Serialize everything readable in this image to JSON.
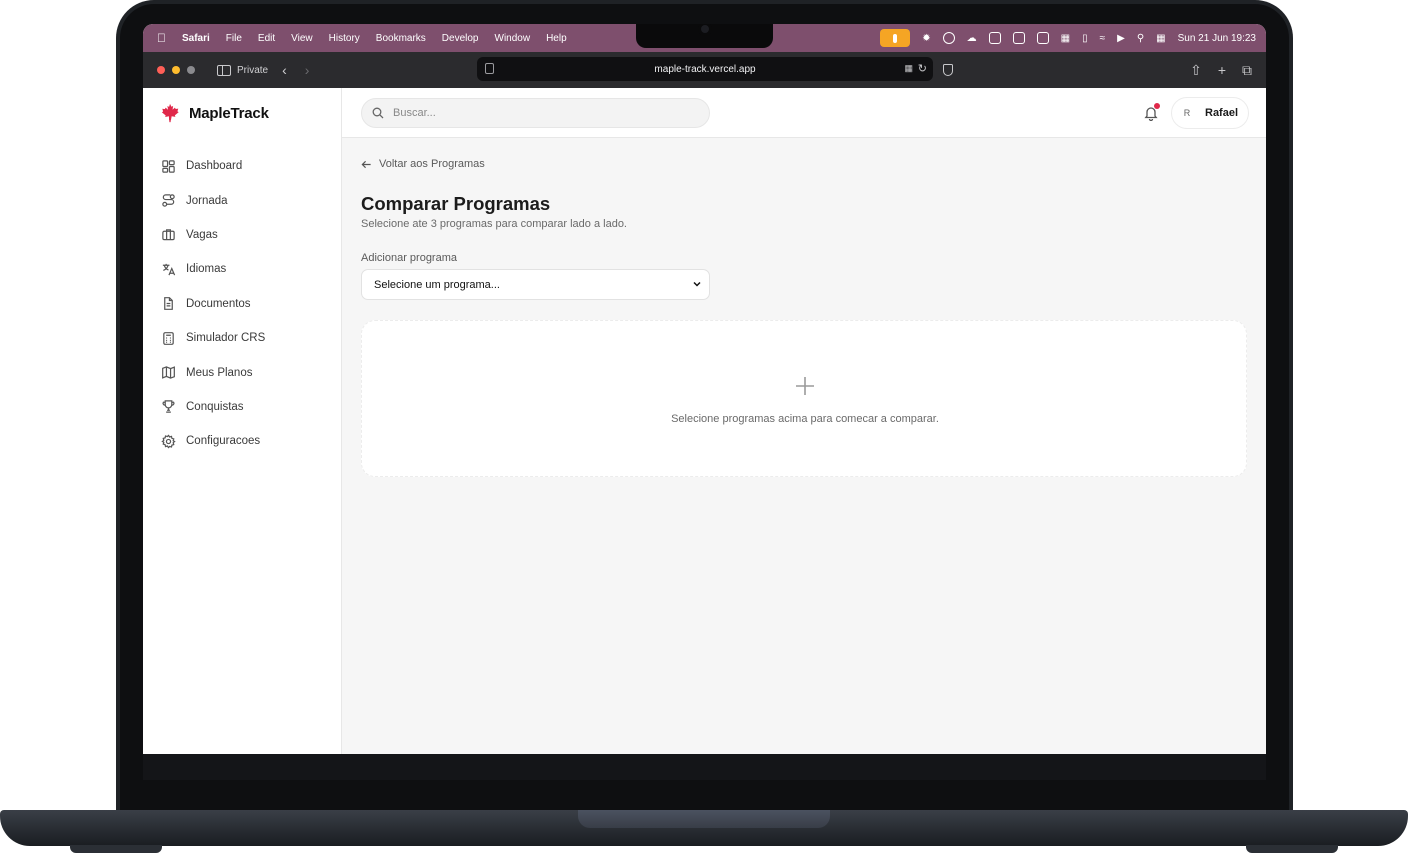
{
  "menubar": {
    "app_name": "Safari",
    "menus": [
      "File",
      "Edit",
      "View",
      "History",
      "Bookmarks",
      "Develop",
      "Window",
      "Help"
    ],
    "clock": "Sun 21 Jun  19:23"
  },
  "browser": {
    "private_label": "Private",
    "url": "maple-track.vercel.app"
  },
  "app": {
    "brand": "MapleTrack",
    "brand_color": "#e0284a",
    "sidebar": {
      "items": [
        {
          "label": "Dashboard",
          "icon": "dashboard-icon"
        },
        {
          "label": "Jornada",
          "icon": "route-icon"
        },
        {
          "label": "Vagas",
          "icon": "briefcase-icon"
        },
        {
          "label": "Idiomas",
          "icon": "translate-icon"
        },
        {
          "label": "Documentos",
          "icon": "file-icon"
        },
        {
          "label": "Simulador CRS",
          "icon": "calculator-icon"
        },
        {
          "label": "Meus Planos",
          "icon": "map-icon"
        },
        {
          "label": "Conquistas",
          "icon": "trophy-icon"
        },
        {
          "label": "Configuracoes",
          "icon": "gear-icon"
        }
      ]
    },
    "topbar": {
      "search_placeholder": "Buscar...",
      "user_initial": "R",
      "user_name": "Rafael"
    },
    "main": {
      "back_label": "Voltar aos Programas",
      "title": "Comparar Programas",
      "subtitle": "Selecione ate 3 programas para comparar lado a lado.",
      "select_label": "Adicionar programa",
      "select_value": "Selecione um programa...",
      "empty_text": "Selecione programas acima para comecar a comparar."
    }
  }
}
